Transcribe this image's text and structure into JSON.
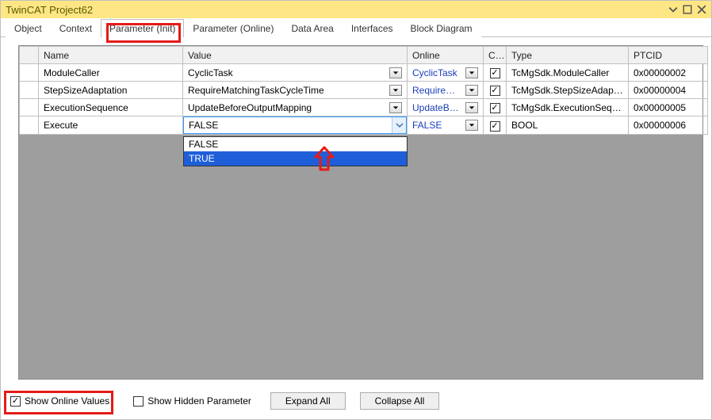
{
  "window": {
    "title": "TwinCAT Project62"
  },
  "tabs": {
    "items": [
      {
        "label": "Object"
      },
      {
        "label": "Context"
      },
      {
        "label": "Parameter (Init)",
        "active": true
      },
      {
        "label": "Parameter (Online)"
      },
      {
        "label": "Data Area"
      },
      {
        "label": "Interfaces"
      },
      {
        "label": "Block Diagram"
      }
    ]
  },
  "headers": {
    "name": "Name",
    "value": "Value",
    "online": "Online",
    "cs": "CS",
    "type": "Type",
    "ptcid": "PTCID"
  },
  "rows": [
    {
      "name": "ModuleCaller",
      "value": "CyclicTask",
      "online": "CyclicTask",
      "cs": true,
      "type": "TcMgSdk.ModuleCaller",
      "ptcid": "0x00000002",
      "editing": false
    },
    {
      "name": "StepSizeAdaptation",
      "value": "RequireMatchingTaskCycleTime",
      "online": "RequireMatc...",
      "cs": true,
      "type": "TcMgSdk.StepSizeAdaptati...",
      "ptcid": "0x00000004",
      "editing": false
    },
    {
      "name": "ExecutionSequence",
      "value": "UpdateBeforeOutputMapping",
      "online": "UpdateBefo...",
      "cs": true,
      "type": "TcMgSdk.ExecutionSequen...",
      "ptcid": "0x00000005",
      "editing": false
    },
    {
      "name": "Execute",
      "value": "FALSE",
      "online": "FALSE",
      "cs": true,
      "type": "BOOL",
      "ptcid": "0x00000006",
      "editing": true
    }
  ],
  "dropdown": {
    "options": [
      {
        "label": "FALSE",
        "selected": false
      },
      {
        "label": "TRUE",
        "selected": true
      }
    ]
  },
  "bottom": {
    "show_online": "Show Online Values",
    "show_hidden": "Show Hidden Parameter",
    "expand": "Expand All",
    "collapse": "Collapse All",
    "show_online_checked": true,
    "show_hidden_checked": false
  }
}
